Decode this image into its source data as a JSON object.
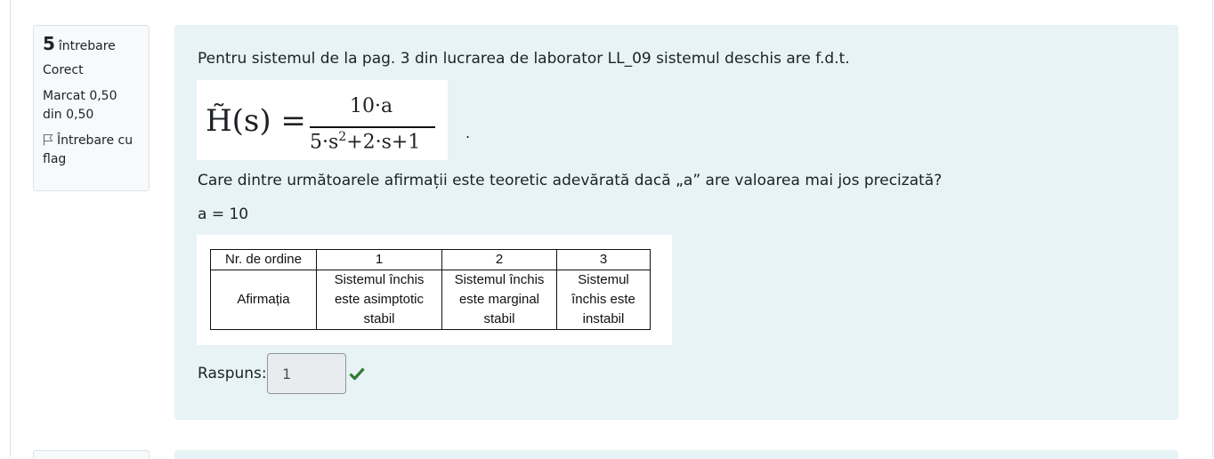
{
  "question_info": {
    "number": "5",
    "number_label": "întrebare",
    "state": "Corect",
    "grade": "Marcat 0,50 din 0,50",
    "flag_label": "Întrebare cu flag",
    "flag_icon": "flag-icon"
  },
  "question": {
    "intro": "Pentru sistemul de la pag. 3 din lucrarea de laborator LL_09 sistemul deschis are f.d.t.",
    "formula": {
      "lhs": "H̃(s) =",
      "numerator": "10·a",
      "denominator_base": "5·s",
      "denominator_exp": "2",
      "denominator_rest": "+2·s+1",
      "trailing": "."
    },
    "prompt": "Care dintre următoarele afirmații este teoretic adevărată dacă „a” are valoarea mai jos precizată?",
    "value": "a = 10",
    "table": {
      "header": [
        "Nr. de ordine",
        "1",
        "2",
        "3"
      ],
      "row_label": "Afirmația",
      "options": [
        [
          "Sistemul închis",
          "este asimptotic",
          "stabil"
        ],
        [
          "Sistemul închis",
          "este marginal",
          "stabil"
        ],
        [
          "Sistemul",
          "închis este",
          "instabil"
        ]
      ]
    }
  },
  "answer": {
    "label": "Raspuns:",
    "value": "1",
    "status_icon": "check-icon",
    "status_color": "#357a32"
  },
  "colors": {
    "content_bg": "#e7f3f5",
    "info_bg": "#f8f9fa"
  }
}
